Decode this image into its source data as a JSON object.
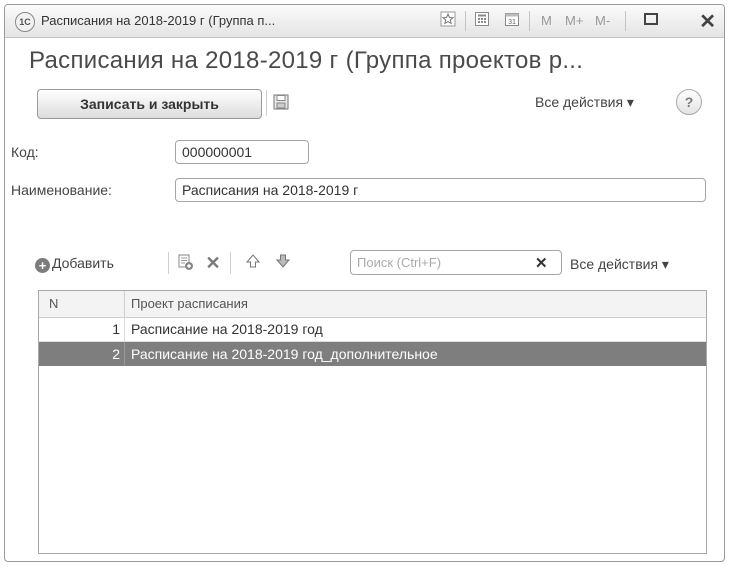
{
  "window": {
    "app_logo_text": "1С",
    "title": "Расписания на 2018-2019 г (Группа п...",
    "memory_buttons": [
      "M",
      "M+",
      "M-"
    ]
  },
  "form": {
    "heading": "Расписания на 2018-2019 г (Группа проектов р...",
    "save_close_label": "Записать и закрыть",
    "all_actions_label": "Все действия ▾",
    "help_label": "?"
  },
  "fields": {
    "code_label": "Код:",
    "code_value": "000000001",
    "name_label": "Наименование:",
    "name_value": "Расписания на 2018-2019 г"
  },
  "table_toolbar": {
    "add_label": "Добавить",
    "search_placeholder": "Поиск (Ctrl+F)",
    "search_clear": "✕",
    "all_actions_label": "Все действия ▾"
  },
  "table": {
    "columns": [
      "N",
      "Проект расписания"
    ],
    "rows": [
      {
        "n": "1",
        "name": "Расписание на 2018-2019 год",
        "selected": false
      },
      {
        "n": "2",
        "name": "Расписание на 2018-2019 год_дополнительное",
        "selected": true
      }
    ]
  },
  "icons": {
    "favorite": "star-icon",
    "calculator": "calculator-icon",
    "calendar": "calendar-icon",
    "maximize": "maximize-icon",
    "close": "close-icon",
    "save": "floppy-icon",
    "copy": "copy-add-icon",
    "delete": "delete-x-icon",
    "move_up": "arrow-up-icon",
    "move_down": "arrow-down-icon"
  },
  "colors": {
    "selected_row": "#7e7e7e",
    "title_bar": "#e4e4e4"
  }
}
